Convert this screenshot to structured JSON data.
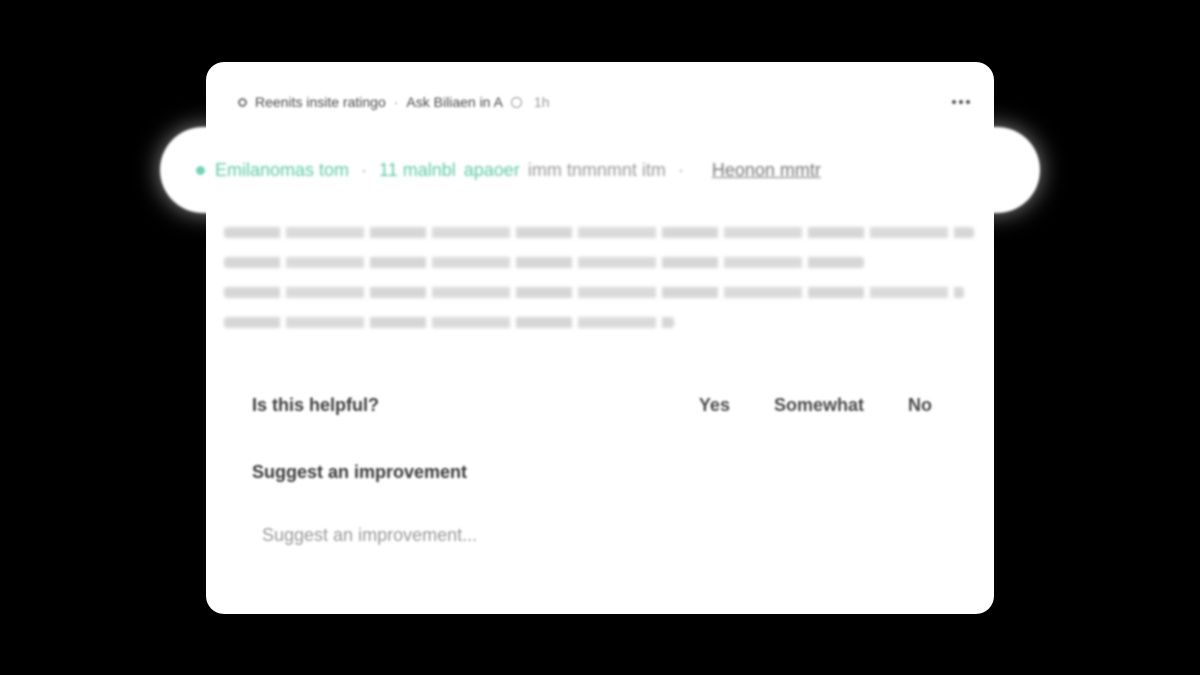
{
  "header": {
    "title": "Reenits insite ratingo",
    "separator": "·",
    "author": "Ask Biliaen in A",
    "meta": "1h"
  },
  "highlight": {
    "label": "Emilanomas tom",
    "sep1": "·",
    "count": "11 malnbl",
    "action": "apaoer",
    "rest": "imm tnmnmnt itm",
    "sep2": "·",
    "link": "Heonon mmtr"
  },
  "feedback": {
    "question": "Is this helpful?",
    "options": [
      "Yes",
      "Somewhat",
      "No"
    ]
  },
  "suggest": {
    "title": "Suggest an improvement",
    "placeholder": "Suggest an improvement..."
  },
  "colors": {
    "background": "#000000",
    "card": "#ffffff",
    "accent": "#5ccaa6"
  }
}
